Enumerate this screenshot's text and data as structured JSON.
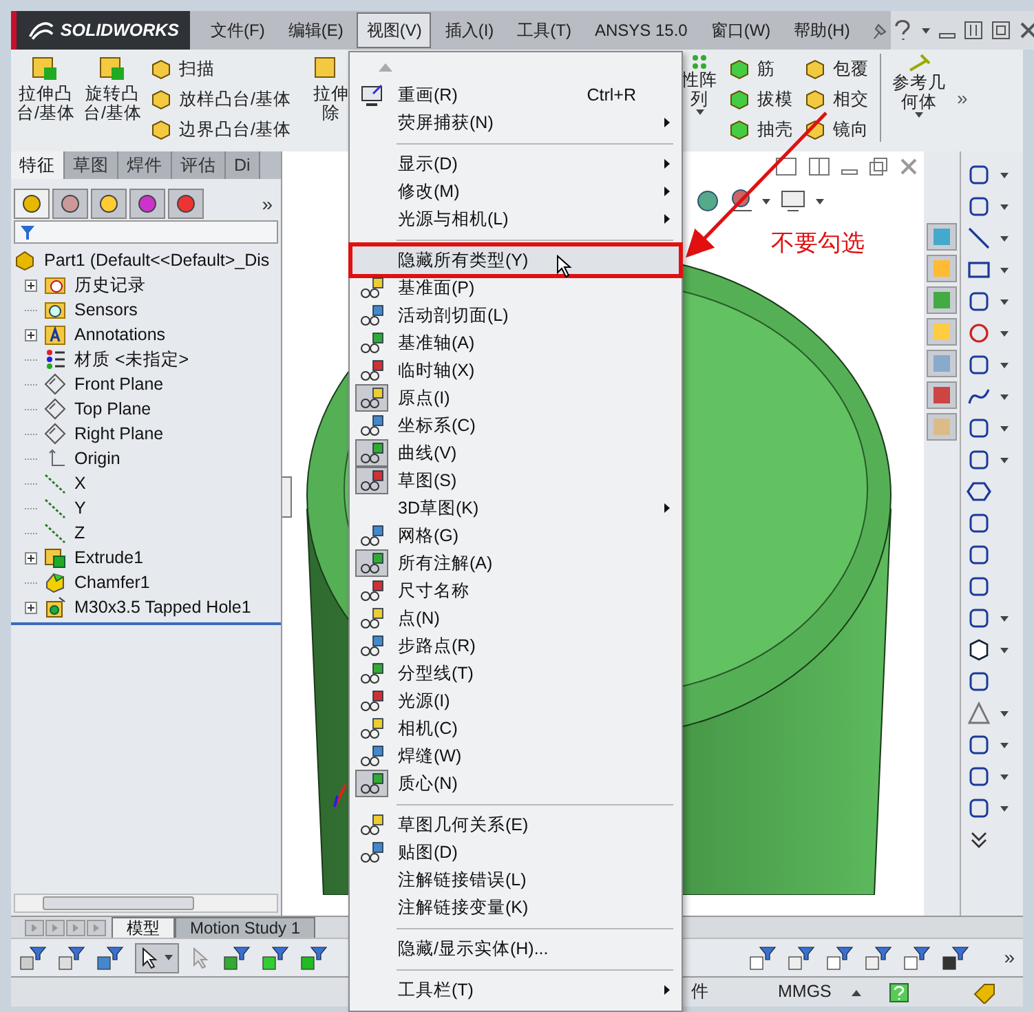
{
  "title_bar": {
    "logo": "SOLIDWORKS",
    "menus": [
      {
        "label": "文件(F)",
        "selected": false
      },
      {
        "label": "编辑(E)",
        "selected": false
      },
      {
        "label": "视图(V)",
        "selected": true
      },
      {
        "label": "插入(I)",
        "selected": false
      },
      {
        "label": "工具(T)",
        "selected": false
      },
      {
        "label": "ANSYS 15.0",
        "selected": false
      },
      {
        "label": "窗口(W)",
        "selected": false
      },
      {
        "label": "帮助(H)",
        "selected": false
      }
    ]
  },
  "ribbon": {
    "left_large": [
      {
        "lines": [
          "拉伸凸",
          "台/基体"
        ]
      },
      {
        "lines": [
          "旋转凸",
          "台/基体"
        ]
      }
    ],
    "left_small": [
      "扫描",
      "放样凸台/基体",
      "边界凸台/基体"
    ],
    "cut_large": {
      "lines": [
        "拉伸",
        "除"
      ]
    },
    "right_large": {
      "lines": [
        "性阵",
        "列"
      ]
    },
    "right_small_a": [
      "筋",
      "拔模",
      "抽壳"
    ],
    "right_small_b": [
      "包覆",
      "相交",
      "镜向"
    ],
    "ref_geometry": {
      "lines": [
        "参考几",
        "何体"
      ]
    },
    "more": "»"
  },
  "feature_tabs": [
    {
      "label": "特征",
      "selected": true
    },
    {
      "label": "草图",
      "selected": false
    },
    {
      "label": "焊件",
      "selected": false
    },
    {
      "label": "评估",
      "selected": false
    },
    {
      "label": "Di",
      "selected": false
    }
  ],
  "panel": {
    "tabs": [
      {
        "selected": true
      },
      {
        "selected": false
      },
      {
        "selected": false
      },
      {
        "selected": false
      },
      {
        "selected": false
      }
    ],
    "more": "»",
    "tree": {
      "label": "Part1  (Default<<Default>_Dis",
      "kind": "part",
      "children": [
        {
          "label": "历史记录",
          "kind": "history",
          "collapsed": true
        },
        {
          "label": "Sensors",
          "kind": "sensors",
          "collapsed": false
        },
        {
          "label": "Annotations",
          "kind": "annotations",
          "collapsed": true
        },
        {
          "label": "材质 <未指定>",
          "kind": "material",
          "collapsed": false
        },
        {
          "label": "Front Plane",
          "kind": "plane",
          "collapsed": false
        },
        {
          "label": "Top Plane",
          "kind": "plane",
          "collapsed": false
        },
        {
          "label": "Right Plane",
          "kind": "plane",
          "collapsed": false
        },
        {
          "label": "Origin",
          "kind": "origin",
          "collapsed": false
        },
        {
          "label": "X",
          "kind": "axis",
          "collapsed": false
        },
        {
          "label": "Y",
          "kind": "axis",
          "collapsed": false
        },
        {
          "label": "Z",
          "kind": "axis",
          "collapsed": false
        },
        {
          "label": "Extrude1",
          "kind": "extrude",
          "collapsed": true
        },
        {
          "label": "Chamfer1",
          "kind": "chamfer",
          "collapsed": false
        },
        {
          "label": "M30x3.5 Tapped Hole1",
          "kind": "hole",
          "collapsed": true
        }
      ]
    }
  },
  "viewport": {
    "note": "不要勾选"
  },
  "view_menu": {
    "items": [
      {
        "kind": "monitor",
        "label": "重画(R)",
        "shortcut": "Ctrl+R",
        "submenu": false,
        "toggled": false,
        "highlighted": false
      },
      {
        "kind": "plain",
        "label": "荧屏捕获(N)",
        "submenu": true,
        "toggled": false,
        "highlighted": false
      },
      {
        "kind": "separator"
      },
      {
        "kind": "plain",
        "label": "显示(D)",
        "submenu": true,
        "toggled": false,
        "highlighted": false
      },
      {
        "kind": "plain",
        "label": "修改(M)",
        "submenu": true,
        "toggled": false,
        "highlighted": false
      },
      {
        "kind": "plain",
        "label": "光源与相机(L)",
        "submenu": true,
        "toggled": false,
        "highlighted": false
      },
      {
        "kind": "separator"
      },
      {
        "kind": "plain",
        "label": "隐藏所有类型(Y)",
        "submenu": false,
        "toggled": false,
        "highlighted": true
      },
      {
        "kind": "glasses",
        "label": "基准面(P)",
        "submenu": false,
        "toggled": false,
        "highlighted": false
      },
      {
        "kind": "glasses",
        "label": "活动剖切面(L)",
        "submenu": false,
        "toggled": false,
        "highlighted": false
      },
      {
        "kind": "glasses",
        "label": "基准轴(A)",
        "submenu": false,
        "toggled": false,
        "highlighted": false
      },
      {
        "kind": "glasses",
        "label": "临时轴(X)",
        "submenu": false,
        "toggled": false,
        "highlighted": false
      },
      {
        "kind": "glasses",
        "label": "原点(I)",
        "submenu": false,
        "toggled": true,
        "highlighted": false
      },
      {
        "kind": "glasses",
        "label": "坐标系(C)",
        "submenu": false,
        "toggled": false,
        "highlighted": false
      },
      {
        "kind": "glasses",
        "label": "曲线(V)",
        "submenu": false,
        "toggled": true,
        "highlighted": false
      },
      {
        "kind": "glasses",
        "label": "草图(S)",
        "submenu": false,
        "toggled": true,
        "highlighted": false
      },
      {
        "kind": "plain",
        "label": "3D草图(K)",
        "submenu": true,
        "toggled": false,
        "highlighted": false
      },
      {
        "kind": "glasses",
        "label": "网格(G)",
        "submenu": false,
        "toggled": false,
        "highlighted": false
      },
      {
        "kind": "glasses",
        "label": "所有注解(A)",
        "submenu": false,
        "toggled": true,
        "highlighted": false
      },
      {
        "kind": "glasses",
        "label": "尺寸名称",
        "submenu": false,
        "toggled": false,
        "highlighted": false
      },
      {
        "kind": "glasses",
        "label": "点(N)",
        "submenu": false,
        "toggled": false,
        "highlighted": false
      },
      {
        "kind": "glasses",
        "label": "步路点(R)",
        "submenu": false,
        "toggled": false,
        "highlighted": false
      },
      {
        "kind": "glasses",
        "label": "分型线(T)",
        "submenu": false,
        "toggled": false,
        "highlighted": false
      },
      {
        "kind": "glasses",
        "label": "光源(I)",
        "submenu": false,
        "toggled": false,
        "highlighted": false
      },
      {
        "kind": "glasses",
        "label": "相机(C)",
        "submenu": false,
        "toggled": false,
        "highlighted": false
      },
      {
        "kind": "glasses",
        "label": "焊缝(W)",
        "submenu": false,
        "toggled": false,
        "highlighted": false
      },
      {
        "kind": "glasses",
        "label": "质心(N)",
        "submenu": false,
        "toggled": true,
        "highlighted": false
      },
      {
        "kind": "separator"
      },
      {
        "kind": "glasses",
        "label": "草图几何关系(E)",
        "submenu": false,
        "toggled": false,
        "highlighted": false
      },
      {
        "kind": "glasses",
        "label": "贴图(D)",
        "submenu": false,
        "toggled": false,
        "highlighted": false
      },
      {
        "kind": "plain",
        "label": "注解链接错误(L)",
        "submenu": false,
        "toggled": false,
        "highlighted": false
      },
      {
        "kind": "plain",
        "label": "注解链接变量(K)",
        "submenu": false,
        "toggled": false,
        "highlighted": false
      },
      {
        "kind": "separator"
      },
      {
        "kind": "plain",
        "label": "隐藏/显示实体(H)...",
        "submenu": false,
        "toggled": false,
        "highlighted": false
      },
      {
        "kind": "separator"
      },
      {
        "kind": "plain",
        "label": "工具栏(T)",
        "submenu": true,
        "toggled": false,
        "highlighted": false
      }
    ]
  },
  "bottom_tabs": [
    {
      "label": "模型",
      "selected": true
    },
    {
      "label": "Motion Study 1",
      "selected": false
    }
  ],
  "filter_toolbar": {
    "more": "»"
  },
  "status_bar": {
    "text": "件",
    "units": "MMGS"
  }
}
